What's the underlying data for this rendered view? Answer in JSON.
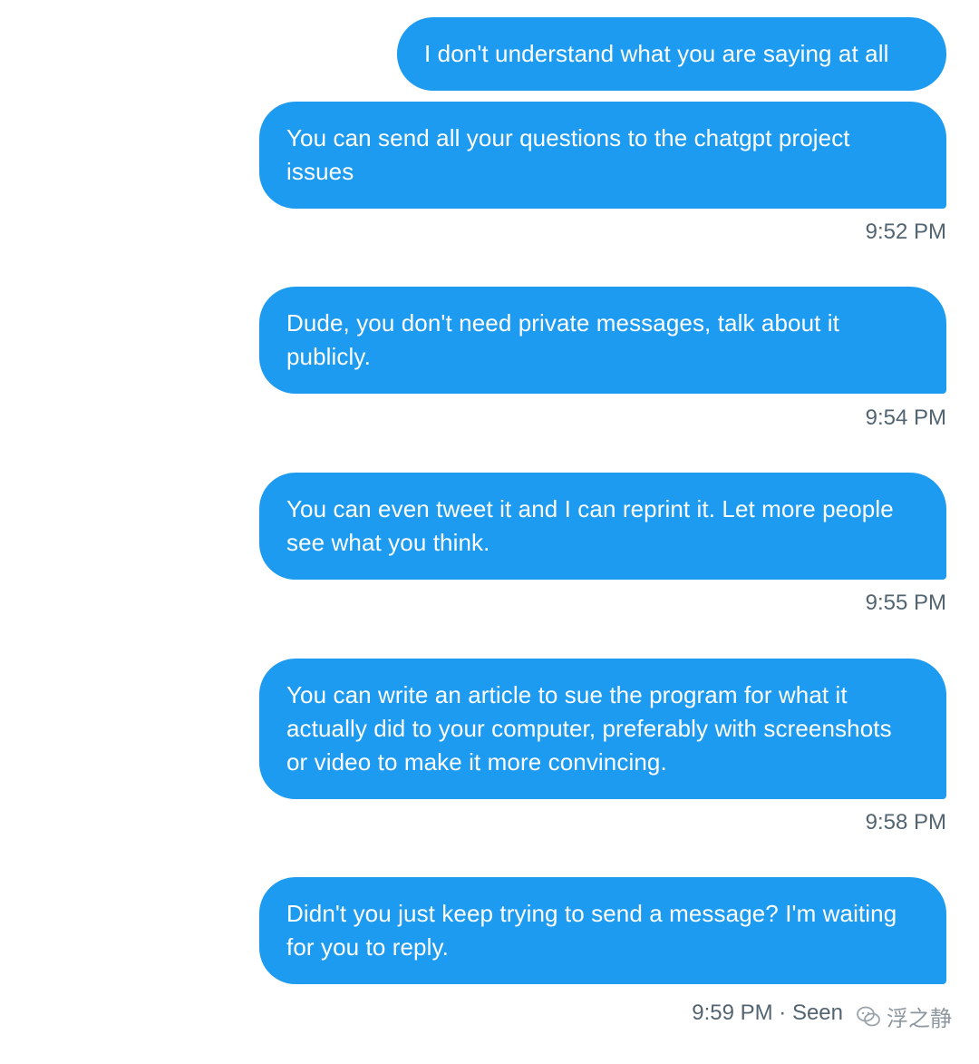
{
  "messages": [
    {
      "text": "I don't understand what you are saying at all",
      "time": ""
    },
    {
      "text": "You can send all your questions to the chatgpt project issues",
      "time": "9:52 PM"
    },
    {
      "text": "Dude, you don't need private messages, talk about it publicly.",
      "time": "9:54 PM"
    },
    {
      "text": "You can even tweet it and I can reprint it. Let more people see what you think.",
      "time": "9:55 PM"
    },
    {
      "text": "You can write an article to sue the program for what it actually did to your computer, preferably with screenshots or video to make it more convincing.",
      "time": "9:58 PM"
    },
    {
      "text": "Didn't you just keep trying to send a message? I'm waiting for you to reply.",
      "time": "9:59 PM · Seen"
    }
  ],
  "watermark": {
    "text": "浮之静"
  },
  "colors": {
    "bubble": "#1d9bf0",
    "bubble_text": "#ffffff",
    "timestamp": "#536471"
  }
}
